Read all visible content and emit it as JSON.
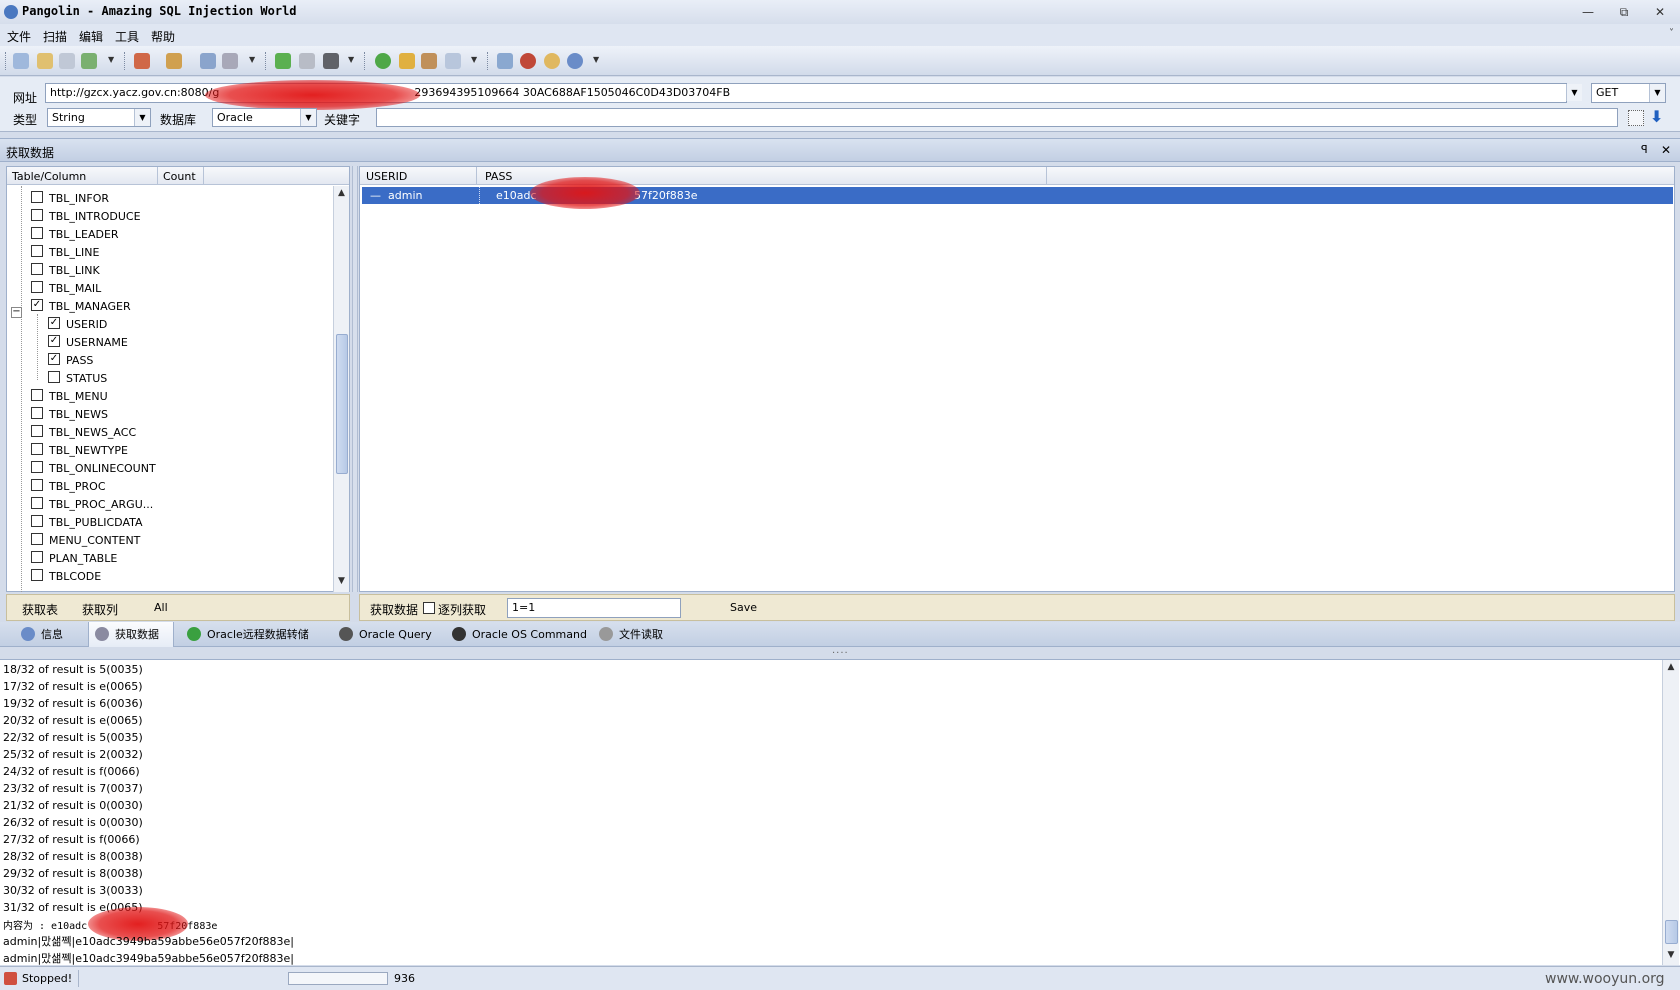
{
  "window": {
    "title": "Pangolin - Amazing SQL Injection World",
    "minimize": "—",
    "restore": "⧉",
    "close": "✕"
  },
  "menu": {
    "items": [
      "文件",
      "扫描",
      "编辑",
      "工具",
      "帮助"
    ],
    "chevron": "˅"
  },
  "toolbar": {
    "icons": [
      "search-icon",
      "open-icon",
      "save-icon",
      "export-icon",
      "tools-icon",
      "settings-icon",
      "wrench-icon",
      "database-icon",
      "play-icon",
      "pause-icon",
      "stop-icon",
      "check-icon",
      "key-icon",
      "camera-icon",
      "find-icon",
      "home-icon",
      "bug-icon",
      "paint-icon",
      "info-icon"
    ]
  },
  "url_panel": {
    "url_label": "网址",
    "url_value": "http://gzcx.yacz.gov.cn:8080/g",
    "url_tail": "293694395109664 30AC688AF1505046C0D43D03704FB",
    "method": "GET",
    "type_label": "类型",
    "type_value": "String",
    "db_label": "数据库",
    "db_value": "Oracle",
    "keyword_label": "关键字",
    "keyword_value": ""
  },
  "section": {
    "title": "获取数据",
    "pin": "ꟼ",
    "close": "✕"
  },
  "tree": {
    "headers": {
      "table": "Table/Column",
      "count": "Count"
    },
    "rows": [
      {
        "label": "TBL_INFOR",
        "level": 0,
        "checked": false
      },
      {
        "label": "TBL_INTRODUCE",
        "level": 0,
        "checked": false
      },
      {
        "label": "TBL_LEADER",
        "level": 0,
        "checked": false
      },
      {
        "label": "TBL_LINE",
        "level": 0,
        "checked": false
      },
      {
        "label": "TBL_LINK",
        "level": 0,
        "checked": false
      },
      {
        "label": "TBL_MAIL",
        "level": 0,
        "checked": false
      },
      {
        "label": "TBL_MANAGER",
        "level": 0,
        "checked": true,
        "expanded": true
      },
      {
        "label": "USERID",
        "level": 1,
        "checked": true
      },
      {
        "label": "USERNAME",
        "level": 1,
        "checked": true
      },
      {
        "label": "PASS",
        "level": 1,
        "checked": true
      },
      {
        "label": "STATUS",
        "level": 1,
        "checked": false
      },
      {
        "label": "TBL_MENU",
        "level": 0,
        "checked": false
      },
      {
        "label": "TBL_NEWS",
        "level": 0,
        "checked": false
      },
      {
        "label": "TBL_NEWS_ACC",
        "level": 0,
        "checked": false
      },
      {
        "label": "TBL_NEWTYPE",
        "level": 0,
        "checked": false
      },
      {
        "label": "TBL_ONLINECOUNT",
        "level": 0,
        "checked": false
      },
      {
        "label": "TBL_PROC",
        "level": 0,
        "checked": false
      },
      {
        "label": "TBL_PROC_ARGU...",
        "level": 0,
        "checked": false
      },
      {
        "label": "TBL_PUBLICDATA",
        "level": 0,
        "checked": false
      },
      {
        "label": "MENU_CONTENT",
        "level": 0,
        "checked": false
      },
      {
        "label": "PLAN_TABLE",
        "level": 0,
        "checked": false
      },
      {
        "label": "TBLCODE",
        "level": 0,
        "checked": false
      }
    ],
    "buttons": {
      "get_tables": "获取表",
      "get_columns": "获取列",
      "all": "All"
    }
  },
  "grid": {
    "headers": {
      "userid": "USERID",
      "pass": "PASS"
    },
    "row": {
      "userid": "admin",
      "pass_prefix": "e10adc",
      "pass_suffix": "57f20f883e"
    },
    "footer": {
      "fetch_label": "获取数据",
      "per_column_label": "逐列获取",
      "condition": "1=1",
      "save": "Save"
    }
  },
  "tabs": [
    {
      "label": "信息",
      "icon": "info-icon",
      "color": "#6a8cc8"
    },
    {
      "label": "获取数据",
      "icon": "database-icon",
      "color": "#8a8aa0",
      "active": true
    },
    {
      "label": "Oracle远程数据转储",
      "icon": "globe-icon",
      "color": "#3aa040"
    },
    {
      "label": "Oracle Query",
      "icon": "sql-icon",
      "color": "#555"
    },
    {
      "label": "Oracle OS Command",
      "icon": "terminal-icon",
      "color": "#333"
    },
    {
      "label": "文件读取",
      "icon": "file-icon",
      "color": "#999"
    }
  ],
  "log": {
    "lines": [
      "18/32 of result is 5(0035)",
      "17/32 of result is e(0065)",
      "19/32 of result is 6(0036)",
      "20/32 of result is e(0065)",
      "22/32 of result is 5(0035)",
      "25/32 of result is 2(0032)",
      "24/32 of result is f(0066)",
      "23/32 of result is 7(0037)",
      "21/32 of result is 0(0030)",
      "26/32 of result is 0(0030)",
      "27/32 of result is f(0066)",
      "28/32 of result is 8(0038)",
      "29/32 of result is 8(0038)",
      "30/32 of result is 3(0033)",
      "31/32 of result is e(0065)"
    ],
    "content_line": "内容为 : e10adc",
    "content_tail": "57f20f883e",
    "result_lines": [
      "admin|맜샒쩩|e10adc3949ba59abbe56e057f20f883e|",
      "admin|맜샒쩩|e10adc3949ba59abbe56e057f20f883e|"
    ]
  },
  "status": {
    "text": "Stopped!",
    "count": "936",
    "watermark": "www.wooyun.org"
  }
}
